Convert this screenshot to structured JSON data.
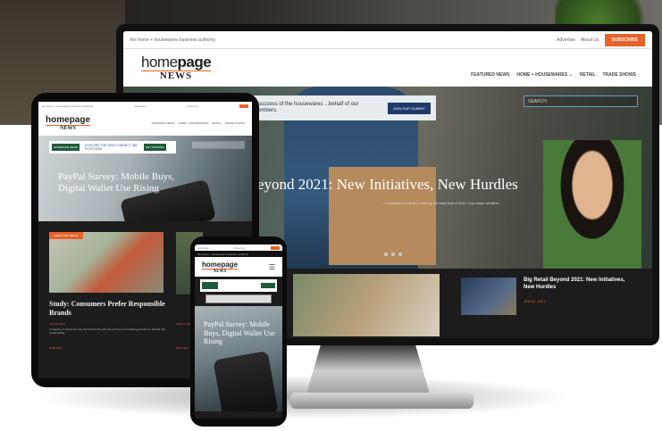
{
  "site": {
    "tagline": "the home + housewares business authority",
    "logo_home": "home",
    "logo_page": "page",
    "logo_news": "NEWS"
  },
  "monitor": {
    "top_links": [
      "Advertise",
      "About Us"
    ],
    "cta": "SUBSCRIBE",
    "nav": [
      "FEATURED NEWS",
      "HOME + HOUSEWARES ⌄",
      "RETAIL",
      "TRADE SHOWS"
    ],
    "banner_text": "...success of the housewares ...behalf of our members.",
    "banner_button": "JOIN OUR SUMMIT",
    "search_placeholder": "SEARCH",
    "hero_title": "eyond 2021: New Initiatives, New Hurdles",
    "hero_sub": "...housewares retailers entering the back half of 2021, how major retailers...",
    "side_headline": "Big Retail Beyond 2021: New Initiatives, New Hurdles",
    "side_date": "JUN 22, 2021"
  },
  "tablet": {
    "tagline": "the home + housewares business authority",
    "top_links": [
      "Advertise",
      "About Us"
    ],
    "nav": [
      "FEATURED NEWS",
      "HOME + HOUSEWARES",
      "RETAIL",
      "TRADE SHOWS"
    ],
    "banner_left": "HOMEPAGE NEWS",
    "banner_mid": "EXPLORE THE NEW CONNECT 360 PLATFORM",
    "banner_right": "GET STARTED",
    "hero_title_1": "PayPal Survey: Mobile Buys,",
    "hero_title_2": "Digital Wallet Use Rising",
    "card_tag": "FEATURED NEWS",
    "card_headline": "Study: Consumers Prefer Responsible Brands",
    "card_date": "JUN 22, 2021",
    "card_excerpt": "A majority of consumers say the brands they choose and buy is increasing devotion to brands that sustainability.",
    "read_more": "Read More",
    "side_date": "JUN 21, 2021",
    "side_more": "Read More"
  },
  "phone": {
    "tagline": "the home + housewares business authority",
    "top_links": [
      "Advertise",
      "About Us"
    ],
    "hero_title": "PayPal Survey: Mobile Buys, Digital Wallet Use Rising",
    "menu_icon": "☰"
  }
}
